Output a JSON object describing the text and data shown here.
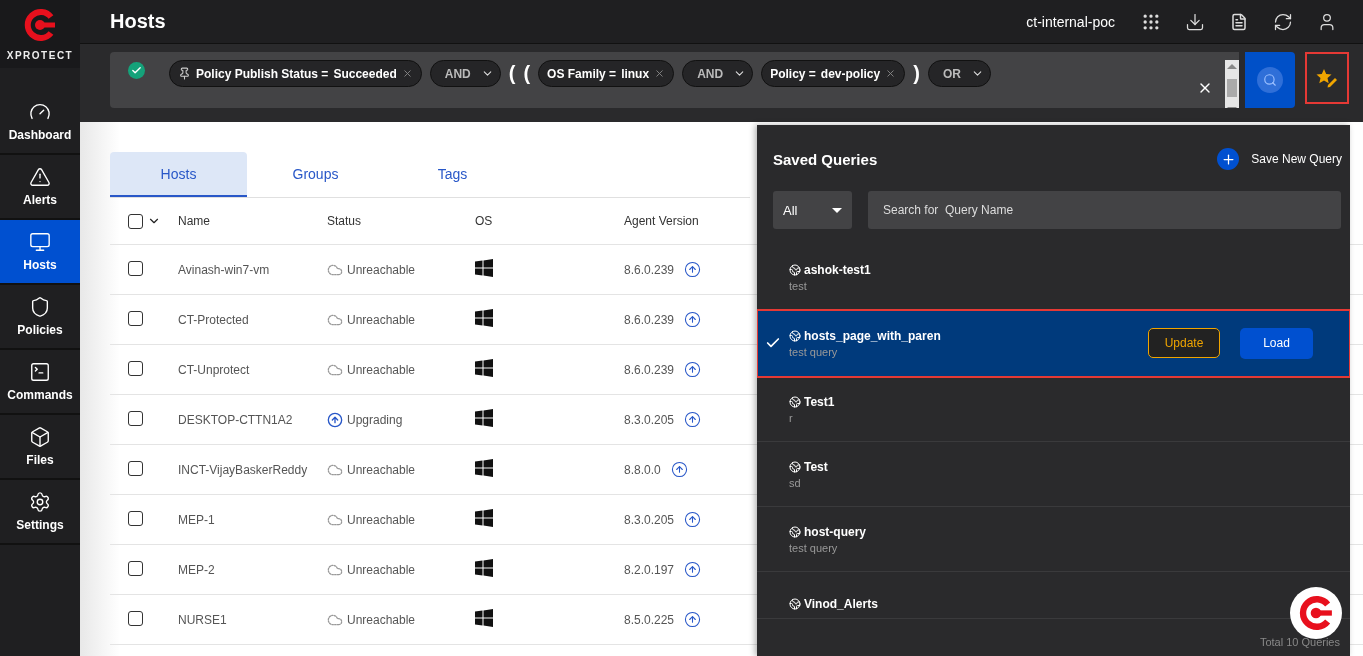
{
  "brand": {
    "name": "XPROTECT"
  },
  "sidebar": {
    "items": [
      {
        "label": "Dashboard",
        "selected": false
      },
      {
        "label": "Alerts",
        "selected": false
      },
      {
        "label": "Hosts",
        "selected": true
      },
      {
        "label": "Policies",
        "selected": false
      },
      {
        "label": "Commands",
        "selected": false
      },
      {
        "label": "Files",
        "selected": false
      },
      {
        "label": "Settings",
        "selected": false
      }
    ]
  },
  "header": {
    "title": "Hosts",
    "tenant": "ct-internal-poc"
  },
  "query_bar": {
    "valid": true,
    "tokens": [
      {
        "kind": "condition",
        "field": "Policy Publish Status =",
        "value": "Succeeded",
        "pinned": true
      },
      {
        "kind": "operator",
        "label": "AND"
      },
      {
        "kind": "paren",
        "label": "("
      },
      {
        "kind": "paren",
        "label": "("
      },
      {
        "kind": "condition",
        "field": "OS Family =",
        "value": "linux",
        "pinned": false
      },
      {
        "kind": "operator",
        "label": "AND"
      },
      {
        "kind": "condition",
        "field": "Policy =",
        "value": "dev-policy",
        "pinned": false
      },
      {
        "kind": "paren",
        "label": ")"
      },
      {
        "kind": "operator",
        "label": "OR"
      }
    ],
    "saved_queries_open": true
  },
  "tabs": [
    {
      "label": "Hosts",
      "selected": true
    },
    {
      "label": "Groups",
      "selected": false
    },
    {
      "label": "Tags",
      "selected": false
    }
  ],
  "table": {
    "select_all_checked": false,
    "columns": [
      "Name",
      "Status",
      "OS",
      "Agent Version"
    ],
    "rows": [
      {
        "kind": "unreachable",
        "checked": false,
        "name": "Avinash-win7-vm",
        "status": "Unreachable",
        "version": "8.6.0.239"
      },
      {
        "kind": "unreachable",
        "checked": false,
        "name": "CT-Protected",
        "status": "Unreachable",
        "version": "8.6.0.239"
      },
      {
        "kind": "unreachable",
        "checked": false,
        "name": "CT-Unprotect",
        "status": "Unreachable",
        "version": "8.6.0.239"
      },
      {
        "kind": "upgrading",
        "checked": false,
        "name": "DESKTOP-CTTN1A2",
        "status": "Upgrading",
        "version": "8.3.0.205"
      },
      {
        "kind": "unreachable",
        "checked": false,
        "name": "INCT-VijayBaskerReddy",
        "status": "Unreachable",
        "version": "8.8.0.0"
      },
      {
        "kind": "unreachable",
        "checked": false,
        "name": "MEP-1",
        "status": "Unreachable",
        "version": "8.3.0.205"
      },
      {
        "kind": "unreachable",
        "checked": false,
        "name": "MEP-2",
        "status": "Unreachable",
        "version": "8.2.0.197"
      },
      {
        "kind": "unreachable",
        "checked": false,
        "name": "NURSE1",
        "status": "Unreachable",
        "version": "8.5.0.225"
      }
    ]
  },
  "saved_queries": {
    "title": "Saved Queries",
    "save_button": "Save New Query",
    "filter": "All",
    "search": {
      "placeholder": "Search for  Query Name"
    },
    "items": [
      {
        "name": "ashok-test1",
        "description": "test",
        "selected": false
      },
      {
        "name": "hosts_page_with_paren",
        "description": "test query",
        "selected": true
      },
      {
        "name": "Test1",
        "description": "r",
        "selected": false
      },
      {
        "name": "Test",
        "description": "sd",
        "selected": false
      },
      {
        "name": "host-query",
        "description": "test query",
        "selected": false
      },
      {
        "name": "Vinod_Alerts",
        "selected": false
      }
    ],
    "update_button": "Update",
    "load_button": "Load",
    "total": "Total 10 Queries"
  }
}
